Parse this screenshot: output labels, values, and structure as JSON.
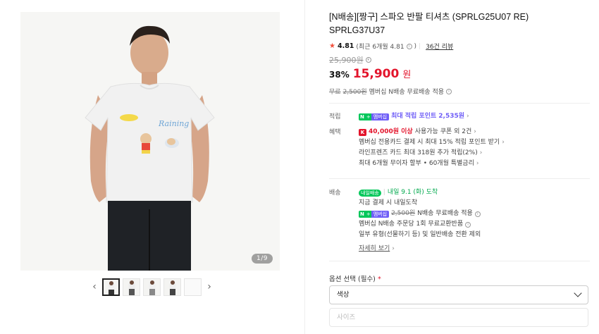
{
  "gallery": {
    "counter": "1/9",
    "prev_icon": "chevron-left-icon",
    "next_icon": "chevron-right-icon",
    "graphic_text": "Raining"
  },
  "product": {
    "title_line1": "[N배송][짱구] 스파오 반팔 티셔츠 (SPRLG25U07 RE)",
    "title_line2": "SPRLG37U37",
    "rating": "4.81",
    "rating_detail": "(최근 6개월 4.81",
    "rating_detail_close": ")",
    "review_count": "36건 리뷰",
    "original_price": "25,900원",
    "discount": "38%",
    "sale_price": "15,900",
    "sale_unit": "원",
    "shipfee_prefix": "무료",
    "shipfee_strike": "2,500원",
    "shipfee_text": "멤버십 N배송 무료배송 적용"
  },
  "benefits": {
    "points_label": "적립",
    "points_badge_n": "N",
    "points_badge_plus": "+",
    "points_badge_mem": "멤버십",
    "points_text": "최대 적립 포인트",
    "points_value": "2,535원",
    "benefit_label": "혜택",
    "coupon_text": "40,000원 이상",
    "coupon_rest": "사용가능 쿠폰 외 2건",
    "card_text": "멤버십 전용카드 결제 시 최대 15% 적립 포인트 받기",
    "line_friends_text": "라인프렌즈 카드 최대 318원 추가 적립(2%)",
    "installment_text": "최대 6개월 무이자 할부 • 60개월 특별금리"
  },
  "shipping": {
    "label": "배송",
    "today_badge": "내일배송",
    "arrival": "내일 9.1 (화) 도착",
    "pay_note": "지금 결제 시 내일도착",
    "fee_strike": "2,500원",
    "fee_text": "N배송 무료배송 적용",
    "exchange_text": "멤버십 N배송 주문당 1회 무료교환반품",
    "exclude_text": "일부 유형(선물하기 등) 및 일반배송 전환 제외",
    "detail_link": "자세히 보기"
  },
  "options": {
    "title": "옵션 선택 (필수)",
    "required_mark": "*",
    "color_select": "색상",
    "size_select": "사이즈"
  },
  "colors": {
    "accent_red": "#e3152c",
    "naver_green": "#03c75a",
    "membership_purple": "#6f5ef7"
  }
}
